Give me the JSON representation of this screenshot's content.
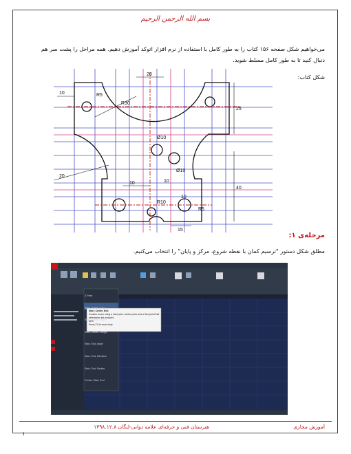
{
  "header": {
    "basmala": "بسم الله الرحمن الرحیم"
  },
  "intro": {
    "text": "می‌خواهیم شکل صفحه ۱۵۶ کتاب را به طور کامل با استفاده از نرم افزار اتوکد آموزش دهیم. همه مراحل را پشت سر هم دنبال کنید تا به طور کامل مسلط شوید."
  },
  "figure_label": "شکل کتاب:",
  "drawing_labels": {
    "d_20_top": "20",
    "d_10_left": "10",
    "d_r5": "R5",
    "d_r30": "R30",
    "d_25_right": "25",
    "d_phi10_a": "Ø10",
    "d_phi10_b": "Ø10",
    "d_10_mid": "10",
    "d_10_bottom": "10",
    "d_10_right": "10",
    "d_15_bottom": "15",
    "d_40_right": "40",
    "d_r10": "R10",
    "d_r5_lower": "R5",
    "d_20_left": "20"
  },
  "stage": {
    "title": "مرحله‌ی ۱:"
  },
  "step": {
    "text": "مطلق شکل دستور \"ترسیم کمان با نقطه شروع، مرکز و پایان\" را انتخاب می‌کنیم."
  },
  "screenshot": {
    "menu_items": [
      "3-Point",
      "Start, Center, End",
      "Start, Center, Angle",
      "Start, Center, Length",
      "Start, End, Angle",
      "Start, End, Direction",
      "Start, End, Radius",
      "Center, Start, End"
    ],
    "tooltip_title": "Start, Center, End",
    "tooltip_text": "Creates an arc using a start point, center point, and a third point that determines the endpoint",
    "tooltip_cmd": "ARC",
    "tooltip_help": "Press F1 for more help"
  },
  "footer": {
    "right": "آموزش مجازی",
    "center": "هنرستان فنی و حرفه‌ای علامه دوانی-لنگان ۱۳۹۸.۱۲.۸",
    "page": "۱"
  },
  "colors": {
    "accent": "#c0161c",
    "grid_blue": "#4b50c8",
    "grid_pink": "#d04080",
    "acad_bg": "#1b2231"
  }
}
